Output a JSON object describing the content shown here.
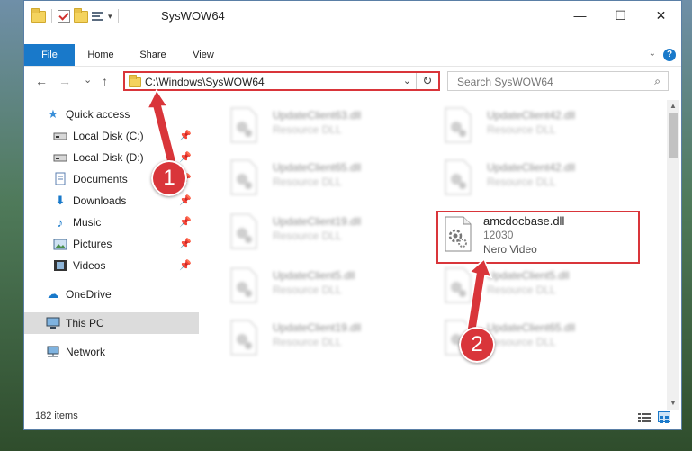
{
  "window": {
    "title": "SysWOW64",
    "controls": {
      "minimize": "—",
      "maximize": "☐",
      "close": "✕"
    }
  },
  "ribbon": {
    "tabs": [
      "File",
      "Home",
      "Share",
      "View"
    ],
    "help": "?"
  },
  "nav": {
    "back": "←",
    "forward": "→",
    "recent": "⌄",
    "up": "↑",
    "address": "C:\\Windows\\SysWOW64",
    "refresh": "↻",
    "search_placeholder": "Search SysWOW64"
  },
  "sidebar": {
    "items": [
      {
        "label": "Quick access",
        "icon": "star-icon"
      },
      {
        "label": "Local Disk (C:)",
        "icon": "drive-icon",
        "pinned": true
      },
      {
        "label": "Local Disk (D:)",
        "icon": "drive-icon",
        "pinned": true
      },
      {
        "label": "Documents",
        "icon": "documents-icon",
        "pinned": true
      },
      {
        "label": "Downloads",
        "icon": "download-icon",
        "pinned": true
      },
      {
        "label": "Music",
        "icon": "music-icon",
        "pinned": true
      },
      {
        "label": "Pictures",
        "icon": "pictures-icon",
        "pinned": true
      },
      {
        "label": "Videos",
        "icon": "videos-icon",
        "pinned": true
      },
      {
        "label": "OneDrive",
        "icon": "cloud-icon"
      },
      {
        "label": "This PC",
        "icon": "computer-icon",
        "active": true
      },
      {
        "label": "Network",
        "icon": "network-icon"
      }
    ]
  },
  "files": {
    "left_column": [
      {
        "name": "UpdateClient63.dll",
        "type": "Resource DLL"
      },
      {
        "name": "UpdateClient65.dll",
        "type": "Resource DLL"
      },
      {
        "name": "UpdateClient19.dll",
        "type": "Resource DLL"
      },
      {
        "name": "UpdateClient5.dll",
        "type": "Resource DLL"
      },
      {
        "name": "UpdateClient19.dll",
        "type": "Resource DLL"
      }
    ],
    "right_column": [
      {
        "name": "UpdateClient42.dll",
        "type": "Resource DLL"
      },
      {
        "name": "UpdateClient42.dll",
        "type": "Resource DLL"
      },
      {
        "name": "UpdateClient5.dll",
        "type": "Resource DLL"
      },
      {
        "name": "UpdateClient65.dll",
        "type": "Resource DLL"
      }
    ],
    "highlighted": {
      "name": "amcdocbase.dll",
      "size": "12030",
      "description": "Nero Video"
    }
  },
  "status": {
    "count": "182 items"
  },
  "markers": [
    "1",
    "2"
  ],
  "colors": {
    "accent": "#1979ca",
    "highlight": "#d9353a"
  }
}
